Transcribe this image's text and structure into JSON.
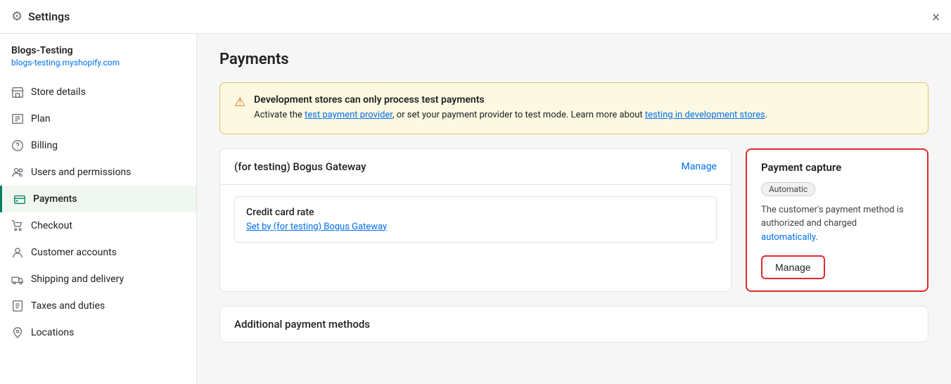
{
  "window": {
    "title": "Settings",
    "close_label": "×"
  },
  "sidebar": {
    "store_name": "Blogs-Testing",
    "store_url": "blogs-testing.myshopify.com",
    "items": [
      {
        "id": "store-details",
        "label": "Store details",
        "icon": "store"
      },
      {
        "id": "plan",
        "label": "Plan",
        "icon": "plan"
      },
      {
        "id": "billing",
        "label": "Billing",
        "icon": "billing"
      },
      {
        "id": "users-permissions",
        "label": "Users and permissions",
        "icon": "users"
      },
      {
        "id": "payments",
        "label": "Payments",
        "icon": "payments",
        "active": true
      },
      {
        "id": "checkout",
        "label": "Checkout",
        "icon": "checkout"
      },
      {
        "id": "customer-accounts",
        "label": "Customer accounts",
        "icon": "customer-accounts"
      },
      {
        "id": "shipping-delivery",
        "label": "Shipping and delivery",
        "icon": "shipping"
      },
      {
        "id": "taxes-duties",
        "label": "Taxes and duties",
        "icon": "taxes"
      },
      {
        "id": "locations",
        "label": "Locations",
        "icon": "locations"
      }
    ]
  },
  "content": {
    "page_title": "Payments",
    "alert": {
      "title": "Development stores can only process test payments",
      "body_prefix": "Activate the ",
      "link1_text": "test payment provider",
      "body_middle": ", or set your payment provider to test mode. Learn more about ",
      "link2_text": "testing in development stores",
      "body_suffix": "."
    },
    "gateway_card": {
      "title": "(for testing) Bogus Gateway",
      "manage_label": "Manage",
      "credit_card_label": "Credit card rate",
      "credit_card_link": "Set by (for testing) Bogus Gateway"
    },
    "payment_capture_card": {
      "title": "Payment capture",
      "badge_label": "Automatic",
      "description_prefix": "The customer's payment method is authorized and charged ",
      "description_link": "automatically",
      "description_suffix": ".",
      "manage_button_label": "Manage"
    },
    "additional_payment": {
      "title": "Additional payment methods"
    }
  }
}
